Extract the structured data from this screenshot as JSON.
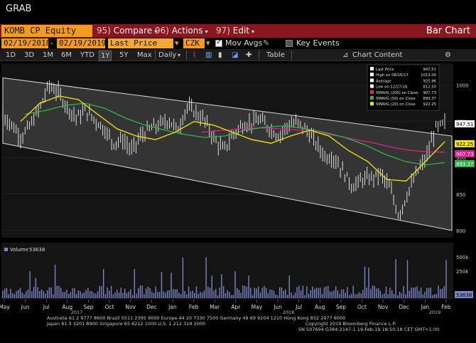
{
  "window": {
    "title": "GRAB"
  },
  "command_bar": {
    "ticker": "KOMB CP Equity",
    "menus": [
      {
        "num": "95)",
        "label": "Compare",
        "caret": "▾"
      },
      {
        "num": "96)",
        "label": "Actions",
        "caret": "▾"
      },
      {
        "num": "97)",
        "label": "Edit",
        "caret": "▾"
      }
    ],
    "title": "Bar Chart"
  },
  "date_bar": {
    "start_date": "02/19/2018",
    "end_date": "02/19/2019",
    "price_field": "Last Price",
    "currency": "CZK",
    "mov_avgs_label": "Mov Avgs",
    "key_events_label": "Key Events"
  },
  "range_tabs": {
    "ranges": [
      "1D",
      "3D",
      "1M",
      "6M",
      "YTD",
      "1Y",
      "5Y",
      "Max"
    ],
    "selected_range": "1Y",
    "frequency": "Daily",
    "table_label": "Table",
    "chart_content_label": "Chart Content"
  },
  "legend": {
    "items": [
      {
        "label": "Last Price",
        "value": "947.51",
        "color": "#ffffff"
      },
      {
        "label": "High on 08/16/17",
        "value": "1013.00",
        "color": "#ffffff"
      },
      {
        "label": "Average",
        "value": "925.96",
        "color": "#ffffff"
      },
      {
        "label": "Low on 12/27/18",
        "value": "812.50",
        "color": "#ffffff"
      },
      {
        "label": "SMAVG (200)  on Close",
        "value": "907.73",
        "color": "#e0208a"
      },
      {
        "label": "SMAVG (50)   on Close",
        "value": "893.37",
        "color": "#31b44b"
      },
      {
        "label": "SMAVG (20)   on Close",
        "value": "922.25",
        "color": "#f2e70c"
      }
    ]
  },
  "volume_panel": {
    "label": "Volume",
    "value": "53638"
  },
  "badges": {
    "last_price": "947.51",
    "sma20": "922.25",
    "sma200": "907.73",
    "sma50": "893.37",
    "volume": "53638"
  },
  "footer": {
    "line1": "Australia 61 2 9777 8600 Brazil 5511 2395 9000 Europe 44 20 7330 7500 Germany 49 69 9204 1210 Hong Kong 852 2977 6000",
    "line2": "Japan 81 3 3201 8900          Singapore 65 6212 1000          U.S. 1 212 318 2000",
    "line3": "Copyright 2019 Bloomberg Finance L.P.",
    "line4": "SN 507694 G384-2147-1 19-Feb-19 18:50:18 CET  GMT+1:00"
  },
  "colors": {
    "command_bar": "#8a1620",
    "field": "#f39a22",
    "sma200": "#e0208a",
    "sma50": "#31b44b",
    "sma20": "#f2e70c",
    "volume": "#7a86c8"
  },
  "chart_data": {
    "type": "bar",
    "title": "",
    "y_ticks": [
      800,
      850,
      900,
      950,
      1000
    ],
    "ylim": [
      790,
      1030
    ],
    "volume_ticks": [
      "500k",
      "250k"
    ],
    "x_ticks": [
      "May",
      "Jun",
      "Jul",
      "Aug",
      "Sep",
      "Oct",
      "Nov",
      "Dec",
      "Jan",
      "Feb",
      "Mar",
      "Apr",
      "May",
      "Jun",
      "Jul",
      "Aug",
      "Sep",
      "Oct",
      "Nov",
      "Dec",
      "Jan",
      "Feb"
    ],
    "year_labels": [
      "2017",
      "2018",
      "2019"
    ],
    "channel": {
      "upper": [
        [
          0,
          1010
        ],
        [
          1,
          930
        ]
      ],
      "lower": [
        [
          0,
          920
        ],
        [
          1,
          800
        ]
      ]
    },
    "approx_close": [
      958,
      945,
      928,
      945,
      968,
      1000,
      990,
      970,
      955,
      965,
      952,
      940,
      920,
      925,
      910,
      930,
      940,
      945,
      952,
      938,
      970,
      962,
      950,
      925,
      910,
      932,
      945,
      948,
      952,
      940,
      930,
      945,
      948,
      938,
      920,
      902,
      900,
      880,
      860,
      870,
      872,
      878,
      860,
      820,
      852,
      880,
      900,
      940,
      947
    ],
    "sma200_approx": [
      935,
      937,
      938,
      940,
      941,
      941,
      940,
      939,
      937,
      935,
      932,
      929,
      925,
      922,
      918,
      914,
      911,
      909,
      908,
      907.73
    ],
    "sma50_approx": [
      960,
      965,
      972,
      975,
      968,
      955,
      945,
      938,
      932,
      928,
      930,
      938,
      942,
      944,
      940,
      935,
      928,
      918,
      905,
      895,
      890,
      893.37
    ],
    "sma20_approx": [
      950,
      975,
      985,
      980,
      960,
      940,
      930,
      925,
      935,
      950,
      945,
      935,
      925,
      920,
      930,
      938,
      930,
      910,
      895,
      870,
      868,
      895,
      922.25
    ]
  }
}
